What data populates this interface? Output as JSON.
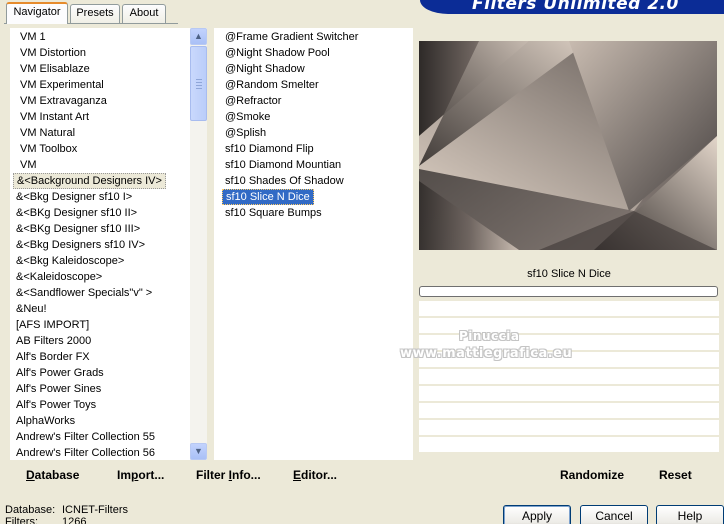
{
  "banner": {
    "title": "Filters Unlimited 2.0"
  },
  "tabs": [
    {
      "label": "Navigator",
      "active": true
    },
    {
      "label": "Presets",
      "active": false
    },
    {
      "label": "About",
      "active": false
    }
  ],
  "categories": [
    "VM 1",
    "VM Distortion",
    "VM Elisablaze",
    "VM Experimental",
    "VM Extravaganza",
    "VM Instant Art",
    "VM Natural",
    "VM Toolbox",
    "VM",
    "&<Background Designers IV>",
    "&<Bkg Designer sf10 I>",
    "&<BKg Designer sf10 II>",
    "&<BKg Designer sf10 III>",
    "&<Bkg Designers sf10 IV>",
    "&<Bkg Kaleidoscope>",
    "&<Kaleidoscope>",
    "&<Sandflower Specials\"v\" >",
    "&Neu!",
    "[AFS IMPORT]",
    "AB Filters 2000",
    "Alf's Border FX",
    "Alf's Power Grads",
    "Alf's Power Sines",
    "Alf's Power Toys",
    "AlphaWorks",
    "Andrew's Filter Collection 55",
    "Andrew's Filter Collection 56"
  ],
  "selected_category_index": 9,
  "filters": [
    "@Frame Gradient Switcher",
    "@Night Shadow Pool",
    "@Night Shadow",
    "@Random Smelter",
    "@Refractor",
    "@Smoke",
    "@Splish",
    "sf10 Diamond Flip",
    "sf10 Diamond Mountian",
    "sf10 Shades Of Shadow",
    "sf10 Slice N Dice",
    "sf10 Square Bumps"
  ],
  "selected_filter_index": 10,
  "preview": {
    "filter_name": "sf10 Slice N Dice"
  },
  "watermark": {
    "line1": "Pinuccia",
    "line2": "www.mattiegrafica.eu"
  },
  "actions": {
    "database": {
      "underline": "D",
      "rest": "atabase"
    },
    "import": {
      "pre": "Im",
      "underline": "p",
      "rest": "ort..."
    },
    "filter_info": {
      "pre": "Filter ",
      "underline": "I",
      "rest": "nfo..."
    },
    "editor": {
      "underline": "E",
      "rest": "ditor..."
    },
    "randomize": "Randomize",
    "reset": "Reset"
  },
  "status": {
    "database_label": "Database:",
    "database_value": "ICNET-Filters",
    "filters_label": "Filters:",
    "filters_value": "1266"
  },
  "buttons": {
    "apply": "Apply",
    "cancel": "Cancel",
    "help": "Help"
  },
  "colors": {
    "selection_blue": "#316ac5",
    "banner_blue": "#0b2c96",
    "window_bg": "#ece9d8"
  }
}
